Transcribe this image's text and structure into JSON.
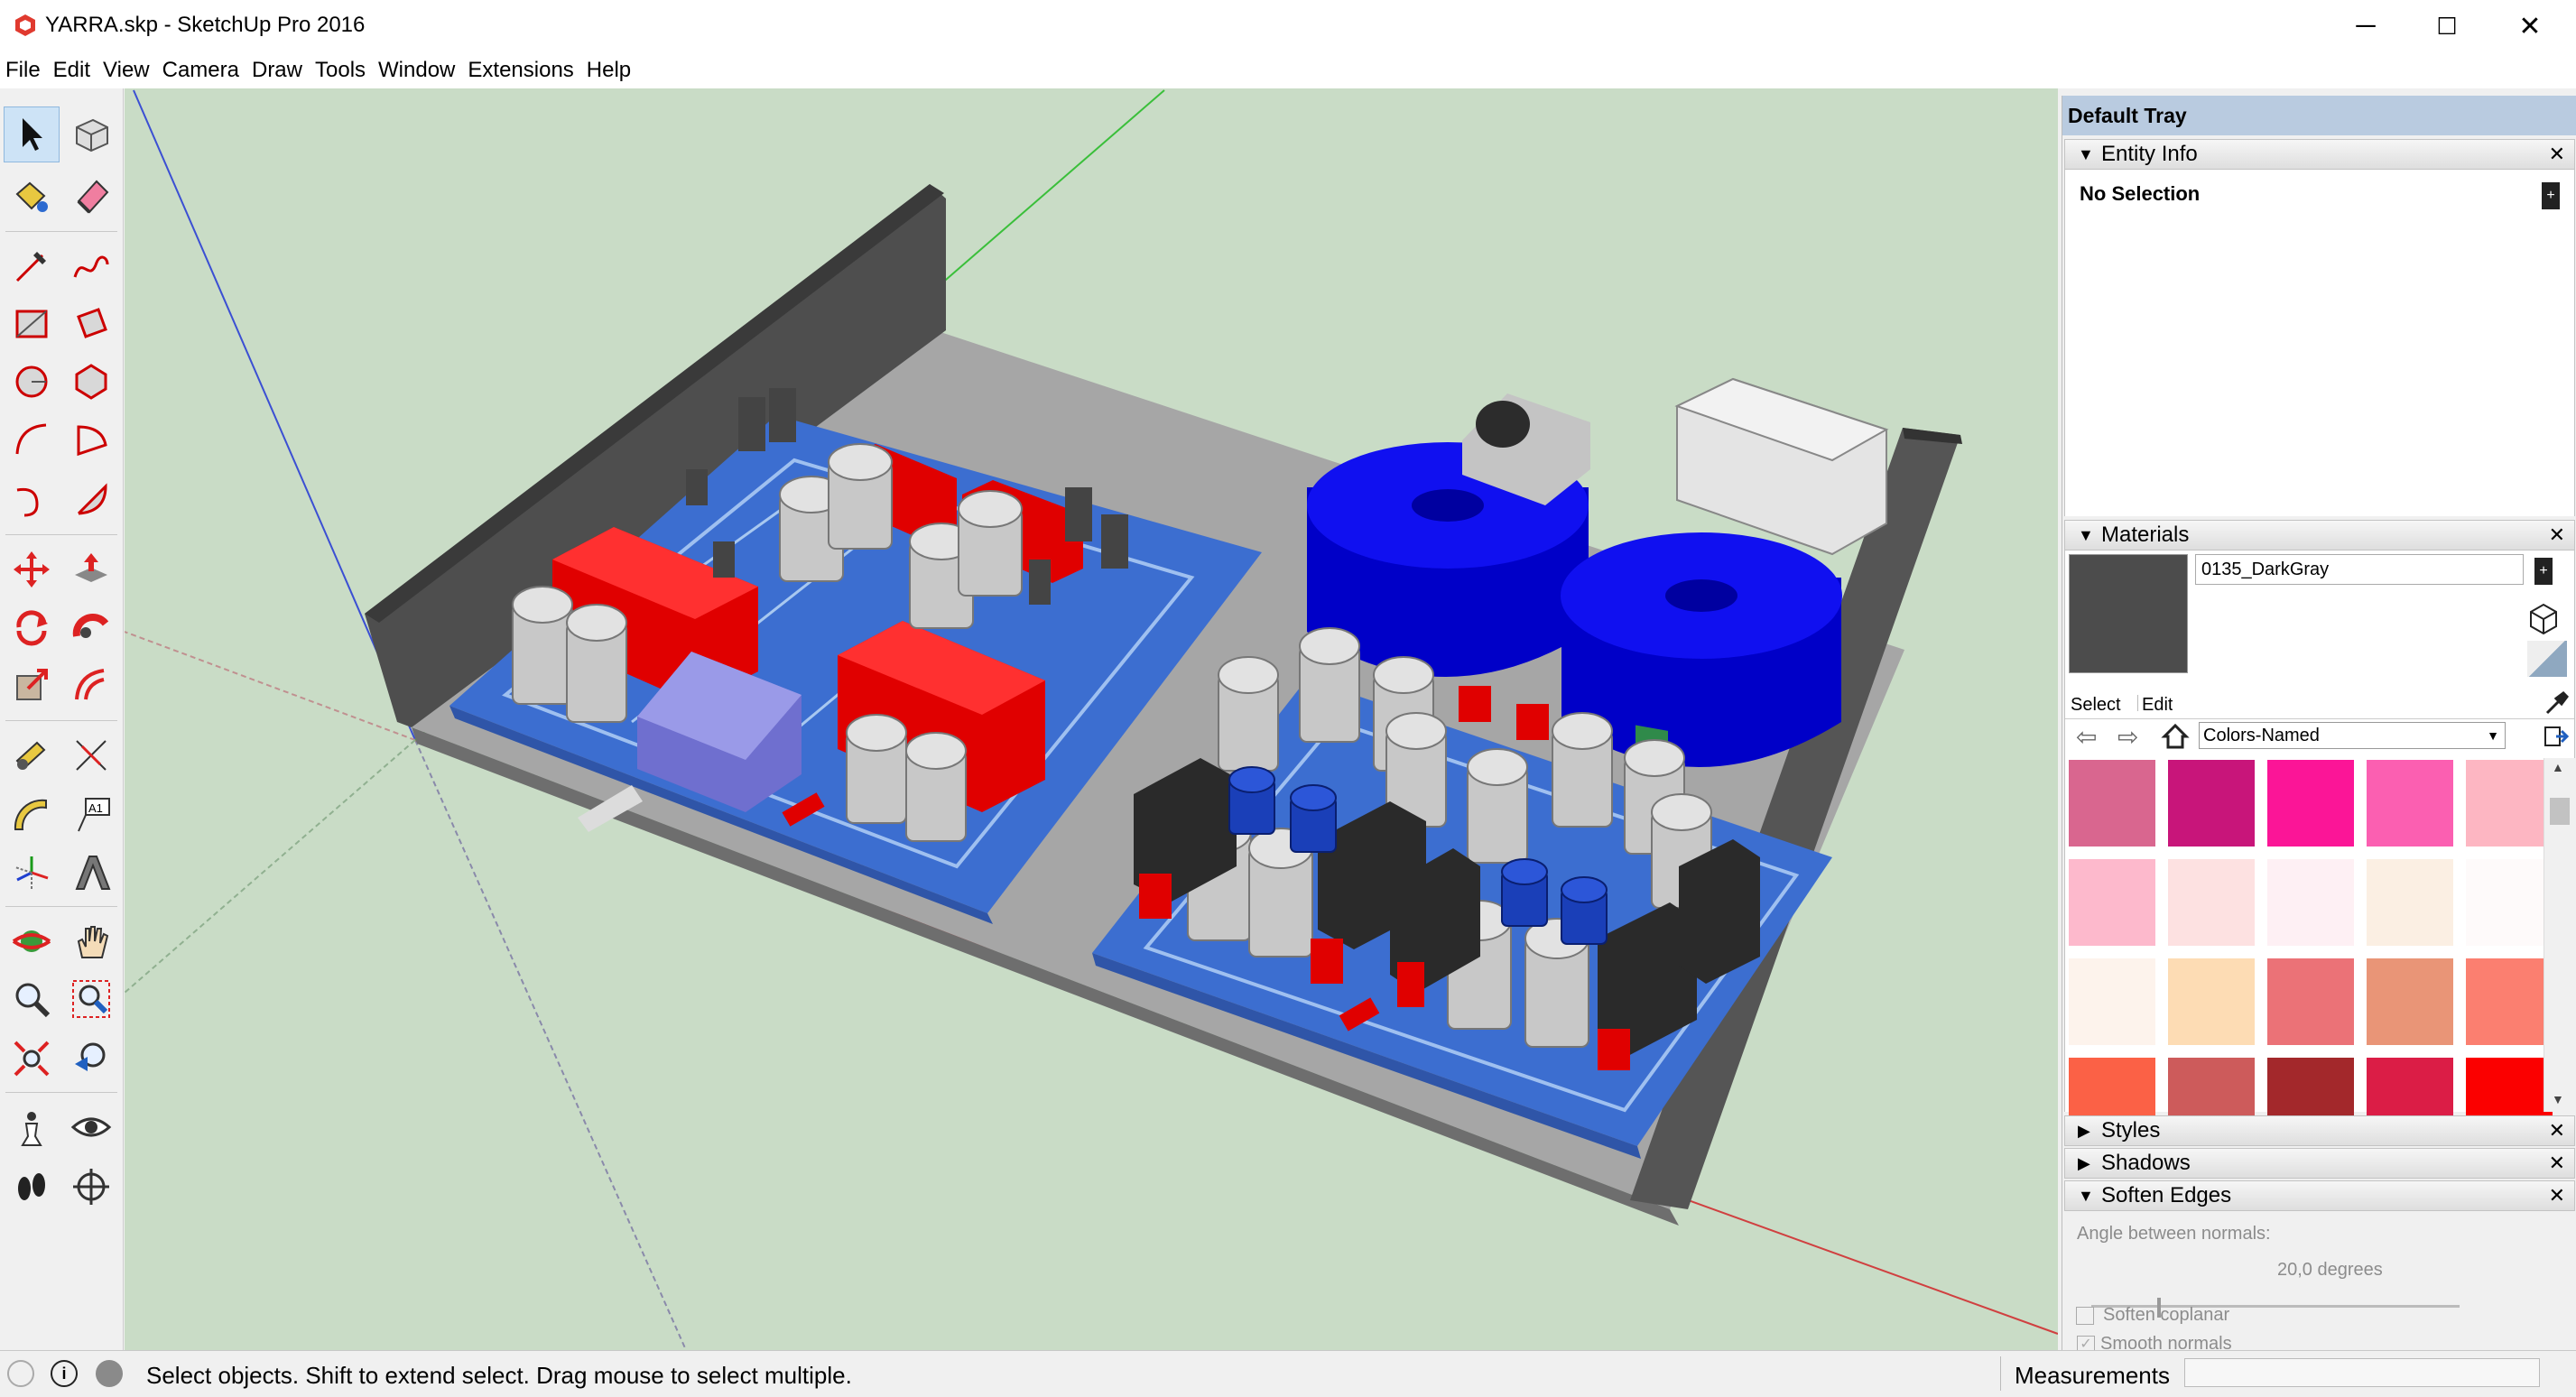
{
  "window": {
    "title": "YARRA.skp - SketchUp Pro 2016",
    "controls": [
      "─",
      "☐",
      "✕"
    ]
  },
  "menu": [
    "File",
    "Edit",
    "View",
    "Camera",
    "Draw",
    "Tools",
    "Window",
    "Extensions",
    "Help"
  ],
  "toolbar": {
    "tools": [
      "select-tool",
      "make-component-tool",
      "paint-bucket-tool",
      "eraser-tool",
      "line-tool",
      "freehand-tool",
      "rectangle-tool",
      "rotated-rectangle-tool",
      "circle-tool",
      "polygon-tool",
      "arc-tool",
      "pie-tool",
      "two-point-arc-tool",
      "three-point-arc-tool",
      "move-tool",
      "push-pull-tool",
      "rotate-tool",
      "follow-me-tool",
      "scale-tool",
      "offset-tool",
      "tape-measure-tool",
      "dimension-tool",
      "protractor-tool",
      "text-tool",
      "axes-tool",
      "3d-text-tool",
      "orbit-tool",
      "pan-tool",
      "zoom-tool",
      "zoom-window-tool",
      "zoom-extents-tool",
      "previous-view-tool",
      "position-camera-tool",
      "look-around-tool",
      "walk-tool",
      "section-plane-tool"
    ],
    "dimension_label": "A1"
  },
  "tray": {
    "title": "Default Tray",
    "entity_info": {
      "title": "Entity Info",
      "selection": "No Selection"
    },
    "materials": {
      "title": "Materials",
      "current_name": "0135_DarkGray",
      "current_color": "#4c4c4c",
      "tab_select": "Select",
      "tab_edit": "Edit",
      "library": "Colors-Named",
      "swatches": [
        "#d9668f",
        "#c8157a",
        "#fb1597",
        "#fb5fb1",
        "#fdb6c2",
        "#fdb9cc",
        "#fde1e1",
        "#fef0f4",
        "#fbefe3",
        "#fefafa",
        "#fdf3ec",
        "#fddcb4",
        "#eb7277",
        "#e99577",
        "#fb7f70",
        "#fb6146",
        "#cd5b5b",
        "#a3282b",
        "#db1d46",
        "#fb0000"
      ]
    },
    "styles_title": "Styles",
    "shadows_title": "Shadows",
    "soften": {
      "title": "Soften Edges",
      "angle_label": "Angle between normals:",
      "angle_value": "20,0  degrees",
      "slider_fraction": 0.18,
      "smooth_normals": "Smooth normals",
      "soften_coplanar": "Soften coplanar"
    }
  },
  "status": {
    "hint": "Select objects. Shift to extend select. Drag mouse to select multiple.",
    "measurements_label": "Measurements"
  }
}
